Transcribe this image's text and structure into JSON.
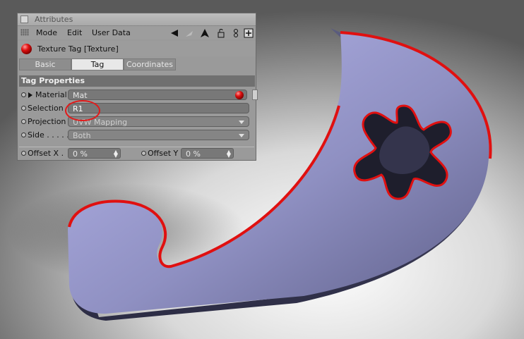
{
  "window": {
    "title": "Attributes"
  },
  "menu": {
    "mode": "Mode",
    "edit": "Edit",
    "user_data": "User Data"
  },
  "tag": {
    "title": "Texture Tag [Texture]"
  },
  "tabs": [
    {
      "label": "Basic",
      "active": false
    },
    {
      "label": "Tag",
      "active": true
    },
    {
      "label": "Coordinates",
      "active": false
    }
  ],
  "section": {
    "title": "Tag Properties"
  },
  "fields": {
    "material": {
      "label": "Material",
      "value": "Mat"
    },
    "selection": {
      "label": "Selection",
      "value": "R1"
    },
    "projection": {
      "label": "Projection",
      "value": "UVW Mapping"
    },
    "side": {
      "label": "Side . . . . .",
      "value": "Both"
    },
    "offset_x": {
      "label": "Offset X  .",
      "value": "0 %"
    },
    "offset_y": {
      "label": "Offset Y",
      "value": "0 %"
    }
  },
  "colors": {
    "object_face": "#8888b8",
    "object_edge": "#e01010",
    "selection_highlight": "#e21b1b"
  }
}
